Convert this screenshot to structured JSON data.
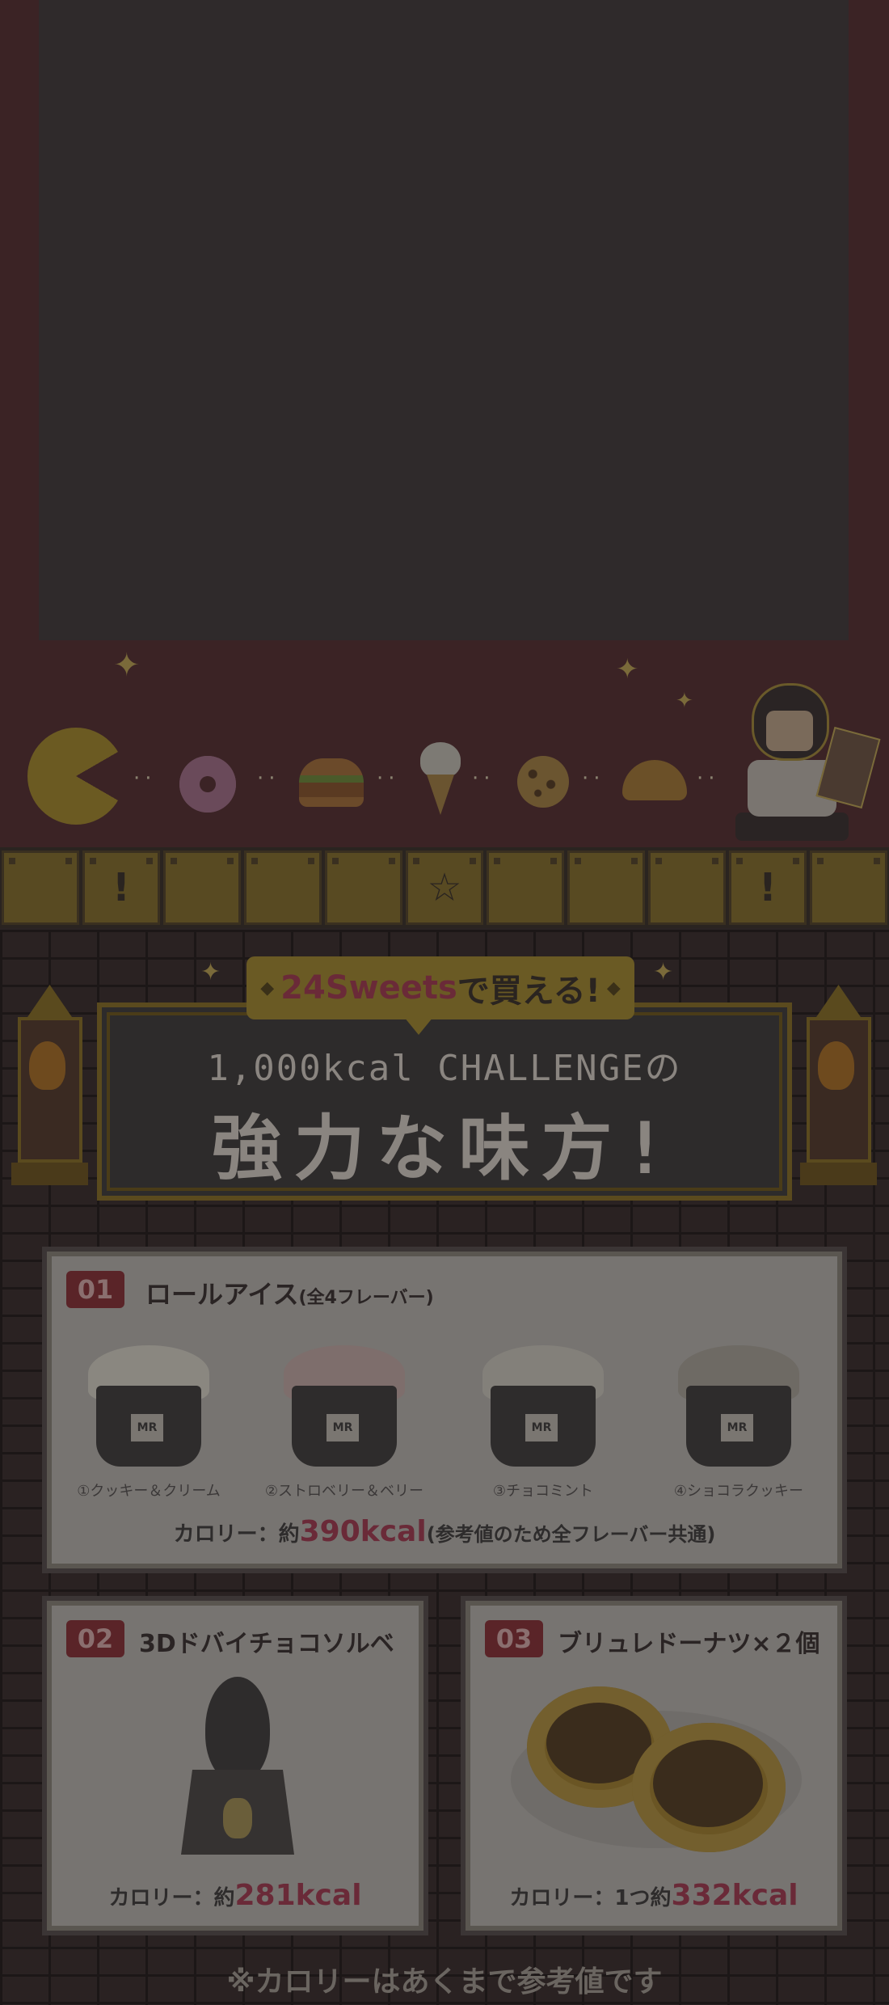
{
  "hero_banner": {
    "badge_accent": "24Sweets",
    "badge_rest": "で買える!",
    "title_sub": "1,000kcal CHALLENGEの",
    "title_main": "強力な味方!"
  },
  "products": [
    {
      "number": "01",
      "name": "ロールアイス",
      "note": "(全4フレーバー)",
      "flavors": [
        {
          "label": "①クッキー＆クリーム",
          "cup_mark": "MR"
        },
        {
          "label": "②ストロベリー＆ベリー",
          "cup_mark": "MR"
        },
        {
          "label": "③チョコミント",
          "cup_mark": "MR"
        },
        {
          "label": "④ショコラクッキー",
          "cup_mark": "MR"
        }
      ],
      "calorie_prefix": "カロリー：約",
      "calorie_value": "390kcal",
      "calorie_suffix": "(参考値のため全フレーバー共通)"
    },
    {
      "number": "02",
      "name": "3Dドバイチョコソルベ",
      "calorie_prefix": "カロリー：約",
      "calorie_value": "281kcal"
    },
    {
      "number": "03",
      "name": "ブリュレドーナツ×２個",
      "calorie_prefix": "カロリー：1つ約",
      "calorie_value": "332kcal"
    }
  ],
  "footnote": "※カロリーはあくまで参考値です",
  "colors": {
    "overlay_background": "#2b2424",
    "accent_red": "#6a2a38",
    "gold": "#6a5a24"
  },
  "icons": [
    "sparkle-icon",
    "pacman-icon",
    "donut-icon",
    "burger-icon",
    "icecream-icon",
    "cookie-icon",
    "croissant-icon",
    "exclamation-block-icon",
    "star-block-icon",
    "torch-icon"
  ]
}
